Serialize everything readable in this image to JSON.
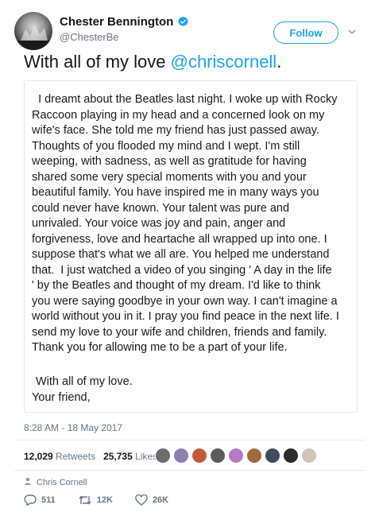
{
  "header": {
    "display_name": "Chester Bennington",
    "handle": "@ChesterBe",
    "follow_label": "Follow"
  },
  "tweet": {
    "text_prefix": "With all of my love ",
    "mention": "@chriscornell",
    "text_suffix": "."
  },
  "letter": {
    "body": "  I dreamt about the Beatles last night. I woke up with Rocky\nRaccoon playing in my head and a concerned look on my\nwife's face. She told me my friend has just passed away.\nThoughts of you flooded my mind and I wept. I'm still\nweeping, with sadness, as well as gratitude for having\nshared some very special moments with you and your\nbeautiful family. You have inspired me in many ways you\ncould never have known. Your talent was pure and\nunrivaled. Your voice was joy and pain, anger and\nforgiveness, love and heartache all wrapped up into one. I\nsuppose that's what we all are. You helped me understand\nthat.  I just watched a video of you singing ' A day in the life\n' by the Beatles and thought of my dream. I'd like to think\nyou were saying goodbye in your own way. I can't imagine a\nworld without you in it. I pray you find peace in the next life. I\nsend my love to your wife and children, friends and family.\nThank you for allowing me to be a part of your life.",
    "closing": "With all of my love.",
    "signoff": "Your friend,"
  },
  "meta": {
    "timestamp": "8:28 AM - 18 May 2017",
    "retweets_count": "12,029",
    "retweets_label": "Retweets",
    "likes_count": "25,735",
    "likes_label": "Likes",
    "reply_to": "Chris Cornell"
  },
  "actions": {
    "reply_count": "511",
    "retweet_count": "12K",
    "like_count": "26K"
  },
  "colors": {
    "accent": "#1da1f2",
    "muted": "#657786"
  },
  "likers": [
    "#6b6b6b",
    "#8d7fb0",
    "#c25a3a",
    "#5b5b5b",
    "#b57ac8",
    "#a06a3a",
    "#3d4d5e",
    "#2c2c2c",
    "#d0c5b8"
  ]
}
